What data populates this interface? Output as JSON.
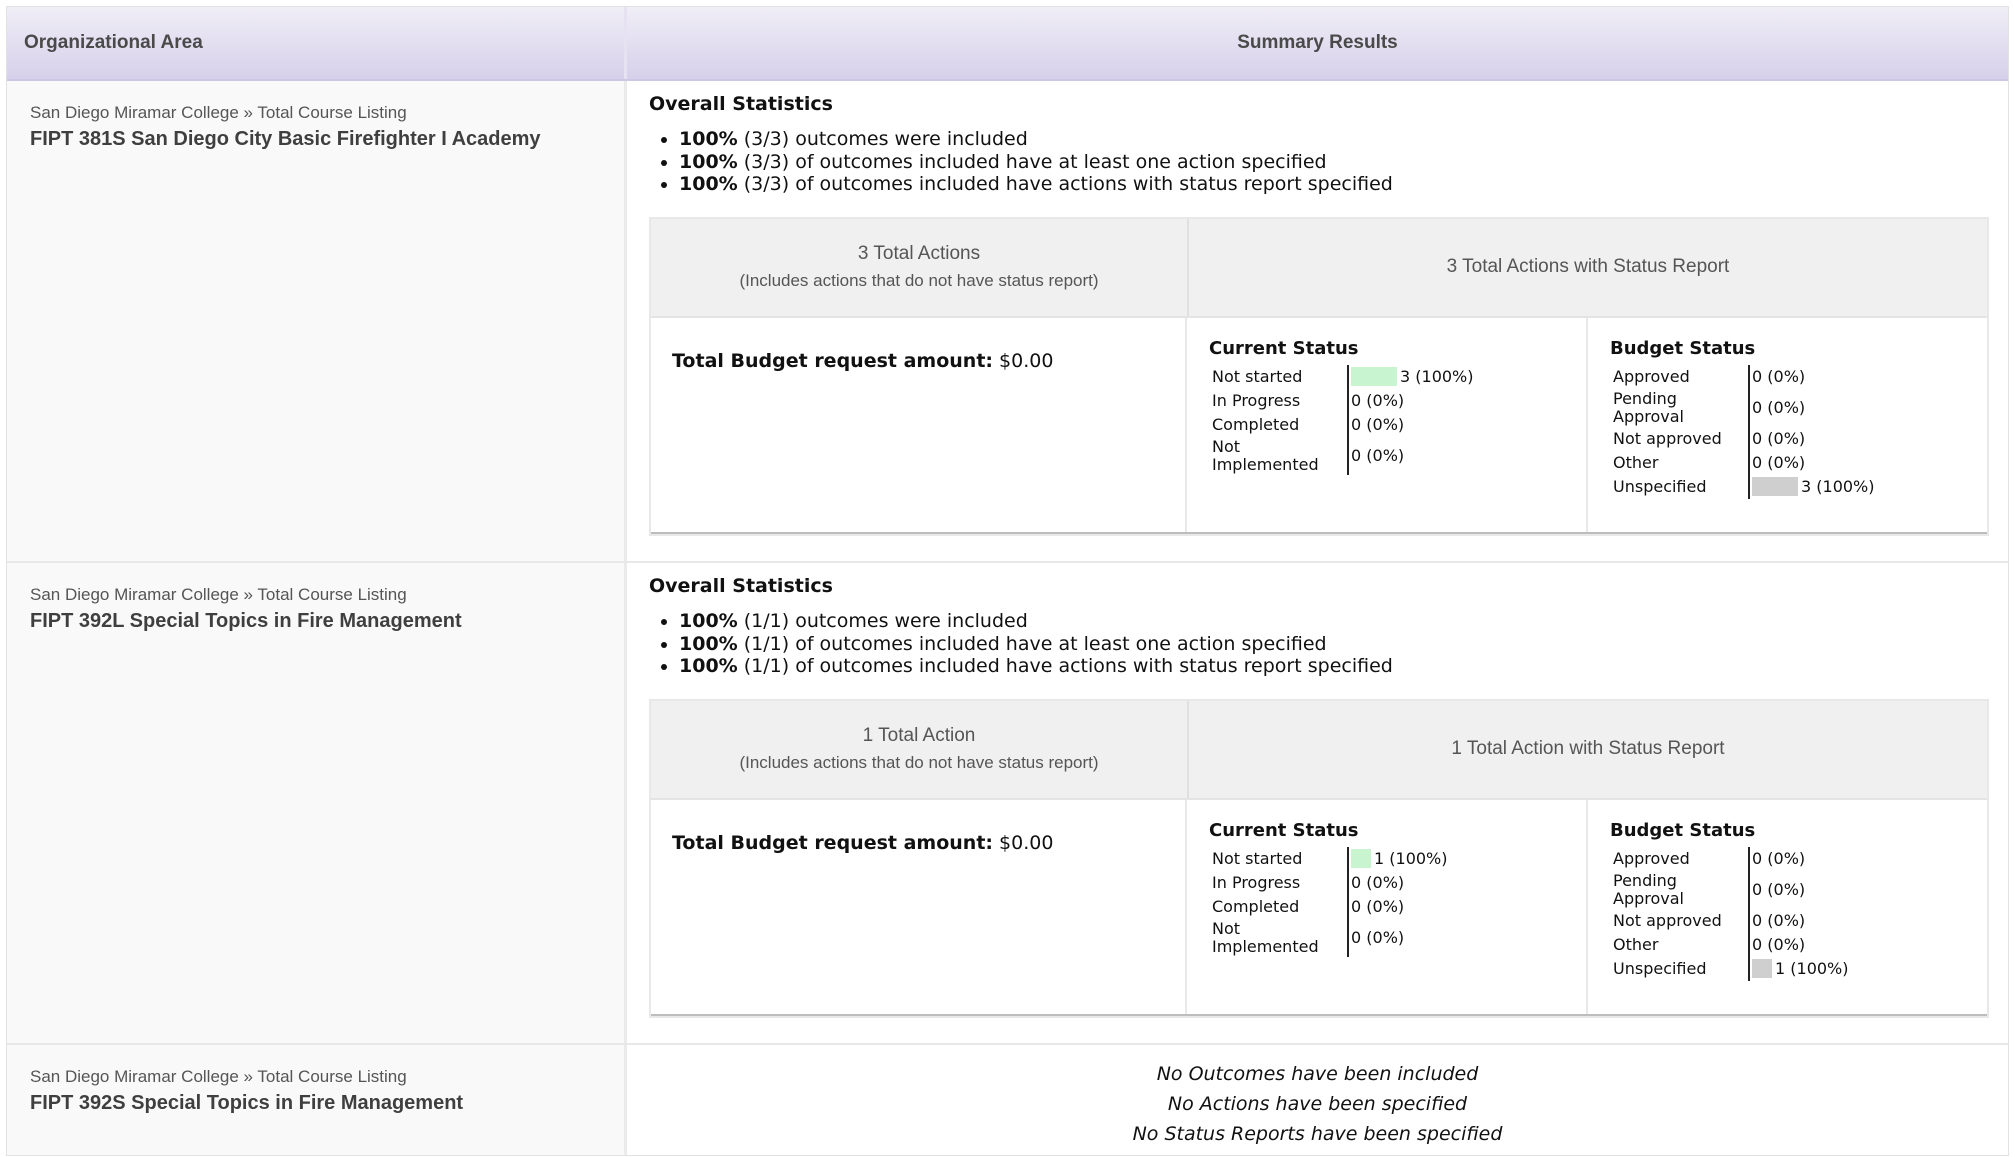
{
  "header": {
    "left": "Organizational Area",
    "right": "Summary Results"
  },
  "rows": [
    {
      "breadcrumb": "San Diego Miramar College » Total Course Listing",
      "course": "FIPT 381S San Diego City Basic Firefighter I Academy",
      "overall_title": "Overall Statistics",
      "stats": [
        {
          "pct": "100%",
          "text": "(3/3) outcomes were included"
        },
        {
          "pct": "100%",
          "text": "(3/3) of outcomes included have at least one action specified"
        },
        {
          "pct": "100%",
          "text": "(3/3) of outcomes included have actions with status report specified"
        }
      ],
      "total_actions": "3 Total Actions",
      "total_actions_note": "(Includes actions that do not have status report)",
      "status_report_actions": "3 Total Actions with Status Report",
      "budget_label": "Total Budget request amount:",
      "budget_value": "$0.00",
      "current_status_title": "Current Status",
      "current_status": [
        {
          "label": "Not started",
          "value": "3 (100%)",
          "fraction": 1.0
        },
        {
          "label": "In Progress",
          "value": "0 (0%)",
          "fraction": 0
        },
        {
          "label": "Completed",
          "value": "0 (0%)",
          "fraction": 0
        },
        {
          "label": "Not Implemented",
          "value": "0 (0%)",
          "fraction": 0
        }
      ],
      "budget_status_title": "Budget Status",
      "budget_status": [
        {
          "label": "Approved",
          "value": "0 (0%)",
          "fraction": 0
        },
        {
          "label": "Pending Approval",
          "value": "0 (0%)",
          "fraction": 0
        },
        {
          "label": "Not approved",
          "value": "0 (0%)",
          "fraction": 0
        },
        {
          "label": "Other",
          "value": "0 (0%)",
          "fraction": 0
        },
        {
          "label": "Unspecified",
          "value": "3 (100%)",
          "fraction": 1.0
        }
      ]
    },
    {
      "breadcrumb": "San Diego Miramar College » Total Course Listing",
      "course": "FIPT 392L Special Topics in Fire Management",
      "overall_title": "Overall Statistics",
      "stats": [
        {
          "pct": "100%",
          "text": "(1/1) outcomes were included"
        },
        {
          "pct": "100%",
          "text": "(1/1) of outcomes included have at least one action specified"
        },
        {
          "pct": "100%",
          "text": "(1/1) of outcomes included have actions with status report specified"
        }
      ],
      "total_actions": "1 Total Action",
      "total_actions_note": "(Includes actions that do not have status report)",
      "status_report_actions": "1 Total Action with Status Report",
      "budget_label": "Total Budget request amount:",
      "budget_value": "$0.00",
      "current_status_title": "Current Status",
      "current_status": [
        {
          "label": "Not started",
          "value": "1 (100%)",
          "fraction": 1.0
        },
        {
          "label": "In Progress",
          "value": "0 (0%)",
          "fraction": 0
        },
        {
          "label": "Completed",
          "value": "0 (0%)",
          "fraction": 0
        },
        {
          "label": "Not Implemented",
          "value": "0 (0%)",
          "fraction": 0
        }
      ],
      "budget_status_title": "Budget Status",
      "budget_status": [
        {
          "label": "Approved",
          "value": "0 (0%)",
          "fraction": 0
        },
        {
          "label": "Pending Approval",
          "value": "0 (0%)",
          "fraction": 0
        },
        {
          "label": "Not approved",
          "value": "0 (0%)",
          "fraction": 0
        },
        {
          "label": "Other",
          "value": "0 (0%)",
          "fraction": 0
        },
        {
          "label": "Unspecified",
          "value": "1 (100%)",
          "fraction": 1.0
        }
      ]
    },
    {
      "breadcrumb": "San Diego Miramar College » Total Course Listing",
      "course": "FIPT 392S Special Topics in Fire Management",
      "empty_lines": [
        "No Outcomes have been included",
        "No Actions have been specified",
        "No Status Reports have been specified"
      ]
    }
  ],
  "colors": {
    "header_bg": "#d6d0ea",
    "current_status_bar": "#c8f5cf",
    "budget_status_bar": "#cfcfcf"
  }
}
